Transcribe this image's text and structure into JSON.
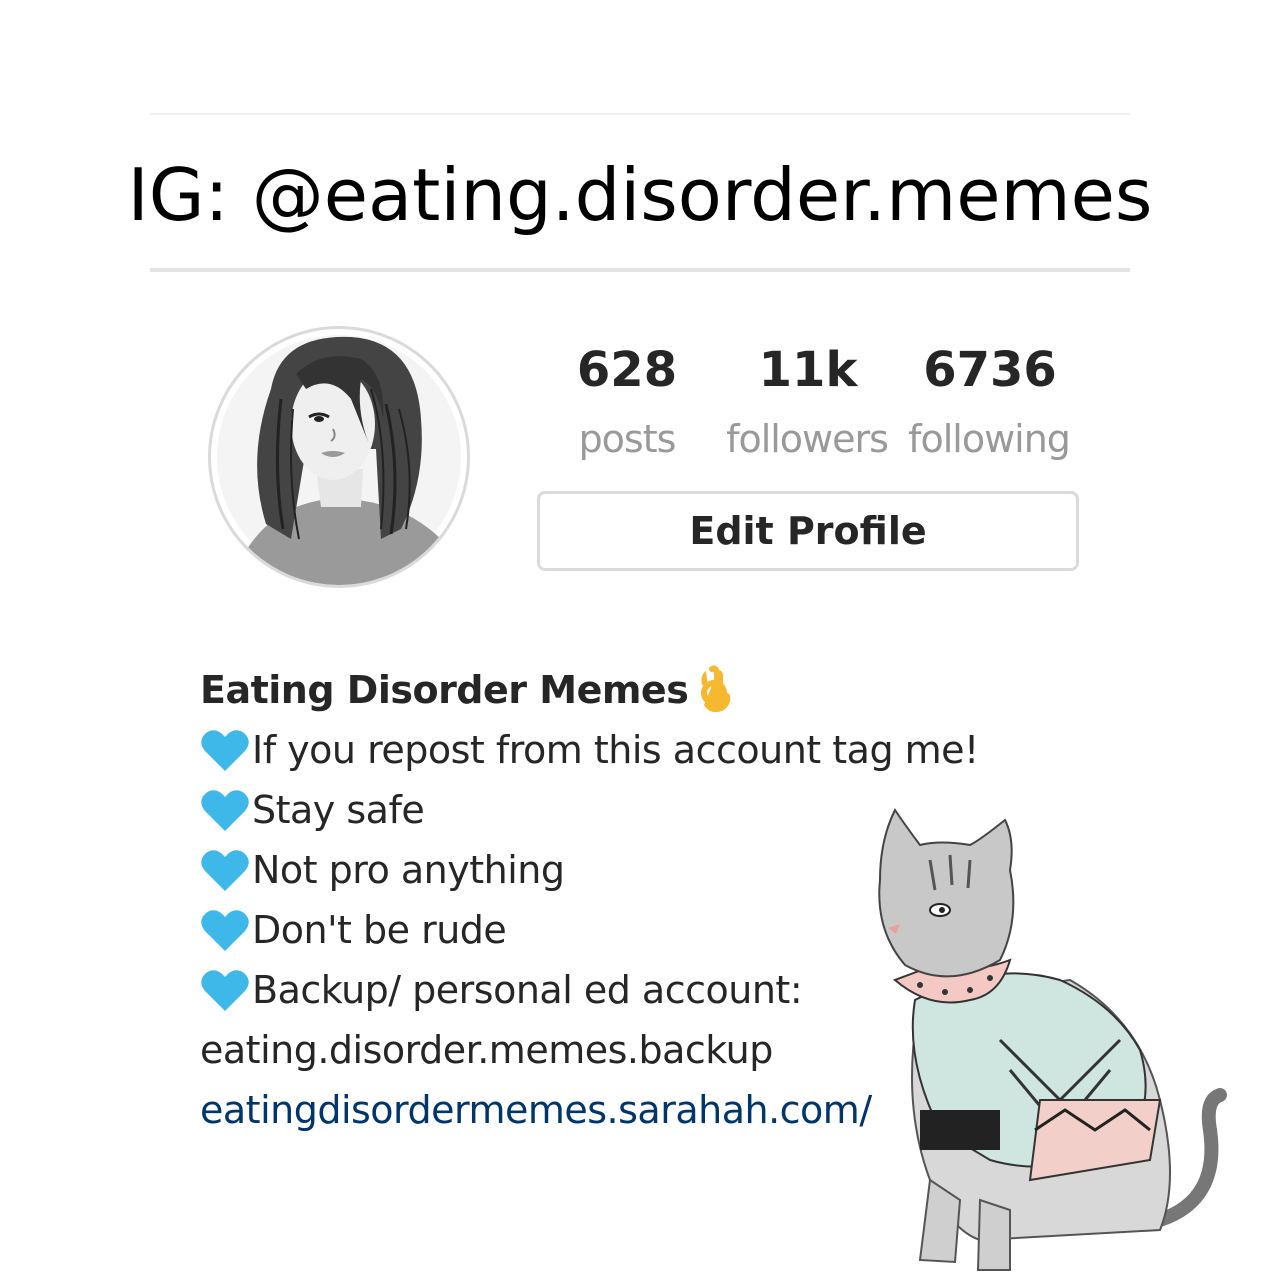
{
  "banner": {
    "title": "IG: @eating.disorder.memes"
  },
  "profile": {
    "stats": [
      {
        "value": "628",
        "label": "posts"
      },
      {
        "value": "11k",
        "label": "followers"
      },
      {
        "value": "6736",
        "label": "following"
      }
    ],
    "edit_button": "Edit Profile"
  },
  "bio": {
    "name": "Eating Disorder Memes",
    "name_emoji": "ok-hand-icon",
    "lines": [
      "If you repost from this account tag me!",
      "Stay safe",
      "Not pro anything",
      "Don't be rude",
      "Backup/ personal ed account:"
    ],
    "backup_account": "eating.disorder.memes.backup",
    "link": "eatingdisordermemes.sarahah.com/",
    "bullet_icon": "blue-heart-icon"
  },
  "colors": {
    "text": "#262626",
    "muted": "#999999",
    "link": "#003569",
    "heart": "#3db8e8",
    "divider": "#e4e4e4"
  }
}
